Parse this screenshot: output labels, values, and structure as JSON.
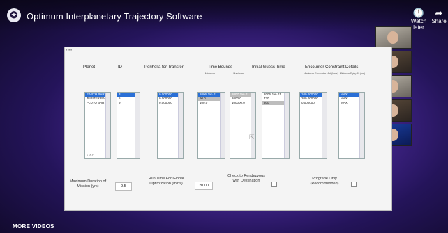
{
  "video": {
    "logo": "✪",
    "title": "Optimum Interplanetary Trajectory Software",
    "watch_later_label": "Watch later",
    "watch_later_icon": "clock-icon",
    "share_label": "Share",
    "share_icon": "share-arrow-icon",
    "more_videos_label": "MORE VIDEOS"
  },
  "app": {
    "headers": {
      "planet": "Planet",
      "id": "ID",
      "perihelia": "Perihelia for Transfer",
      "time_bounds": "Time Bounds",
      "initial_guess": "Initial Guess Time",
      "encounter": "Encounter Constraint Details"
    },
    "subheaders": {
      "minimum": "Minimum",
      "maximum": "Maximum",
      "max_encounter_1": "Maximum Encounter Vinf (km/s)",
      "max_encounter_2": "Minimum Flyby Alt (km)"
    },
    "lists": {
      "planet": {
        "items": [
          "EARTH BARY",
          "JUPITER BAR",
          "PLUTO BARY"
        ],
        "selected": 0,
        "footer": "1 (X-Y)"
      },
      "id": {
        "items": [
          "3",
          "5",
          "9"
        ],
        "selected": 0
      },
      "perihelia": {
        "items": [
          "0.000000",
          "0.000000",
          "0.000000"
        ],
        "selected": 0
      },
      "time_min": {
        "items": [
          "2006 Jan 01",
          "90.0",
          "100.0"
        ],
        "selected": 0,
        "gray": [
          1
        ]
      },
      "time_max": {
        "items": [
          "2007 Jan 01",
          "2000.0",
          "100000.0"
        ],
        "selected": 0,
        "gray": [
          0
        ]
      },
      "initial_guess": {
        "items": [
          "2006 Jan 01",
          "720",
          "300"
        ],
        "selected": -1,
        "gray": [
          2
        ]
      },
      "encounter_vinf": {
        "items": [
          "100.000000",
          "200.000000",
          "0.000000"
        ],
        "selected": 0
      },
      "encounter_alt": {
        "items": [
          "MAX",
          "MAX",
          "MAX"
        ],
        "selected": 0
      }
    },
    "bottom": {
      "max_duration_label": "Maximum Duration of Mission (yrs)",
      "max_duration_value": "9.5",
      "run_time_label": "Run Time For Global Optimization (mins)",
      "run_time_value": "20.00",
      "rendezvous_label": "Check to Rendezvous with Destination",
      "prograde_label": "Prograde Only (Recommended)"
    }
  }
}
